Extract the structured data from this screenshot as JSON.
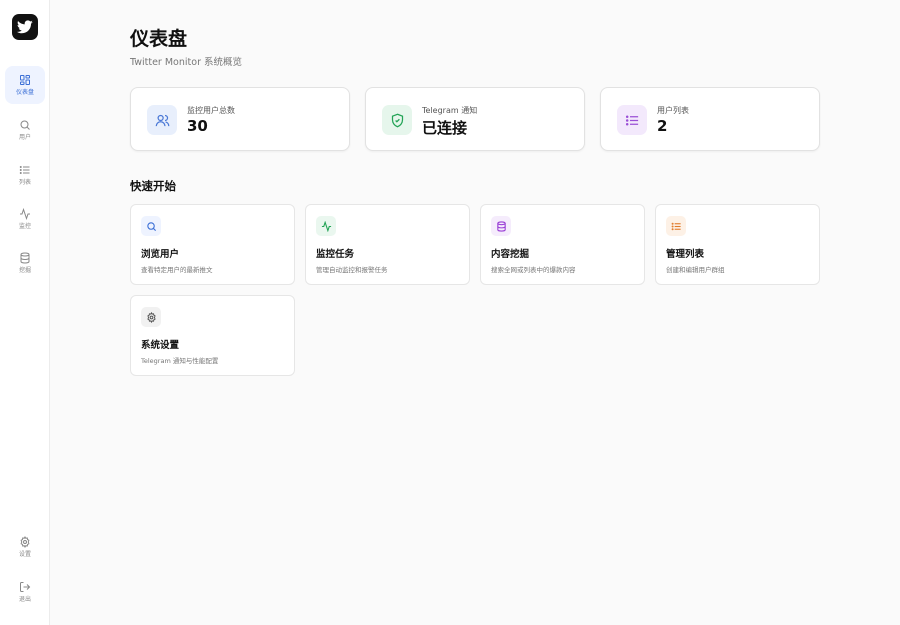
{
  "sidebar": {
    "items": [
      {
        "label": "仪表盘",
        "icon": "dashboard-icon",
        "active": true
      },
      {
        "label": "用户",
        "icon": "search-icon",
        "active": false
      },
      {
        "label": "列表",
        "icon": "list-icon",
        "active": false
      },
      {
        "label": "监控",
        "icon": "activity-icon",
        "active": false
      },
      {
        "label": "挖掘",
        "icon": "database-icon",
        "active": false
      }
    ],
    "bottom_items": [
      {
        "label": "设置",
        "icon": "gear-icon"
      },
      {
        "label": "退出",
        "icon": "logout-icon"
      }
    ]
  },
  "header": {
    "title": "仪表盘",
    "subtitle": "Twitter Monitor 系统概览"
  },
  "stats": [
    {
      "label": "监控用户总数",
      "value": "30",
      "icon": "users-icon",
      "color": "#4a78d6",
      "bg": "#e8effc"
    },
    {
      "label": "Telegram 通知",
      "value": "已连接",
      "icon": "shield-check-icon",
      "color": "#22a355",
      "bg": "#e6f6ec"
    },
    {
      "label": "用户列表",
      "value": "2",
      "icon": "list-icon",
      "color": "#9a4fd6",
      "bg": "#f3e9fc"
    }
  ],
  "quick_start": {
    "title": "快速开始",
    "cards": [
      {
        "title": "浏览用户",
        "desc": "查看特定用户的最新推文",
        "icon": "search-icon",
        "color": "#3b6fd6",
        "bg": "#eef3ff"
      },
      {
        "title": "监控任务",
        "desc": "管理自动监控和报警任务",
        "icon": "activity-icon",
        "color": "#22a355",
        "bg": "#eaf7ef"
      },
      {
        "title": "内容挖掘",
        "desc": "搜索全网或列表中的爆款内容",
        "icon": "database-icon",
        "color": "#9a3fd6",
        "bg": "#f5ecfc"
      },
      {
        "title": "管理列表",
        "desc": "创建和编辑用户群组",
        "icon": "list-icon",
        "color": "#e07a2a",
        "bg": "#fdf1e6"
      },
      {
        "title": "系统设置",
        "desc": "Telegram 通知与性能配置",
        "icon": "gear-icon",
        "color": "#555555",
        "bg": "#f1f1f1"
      }
    ]
  }
}
